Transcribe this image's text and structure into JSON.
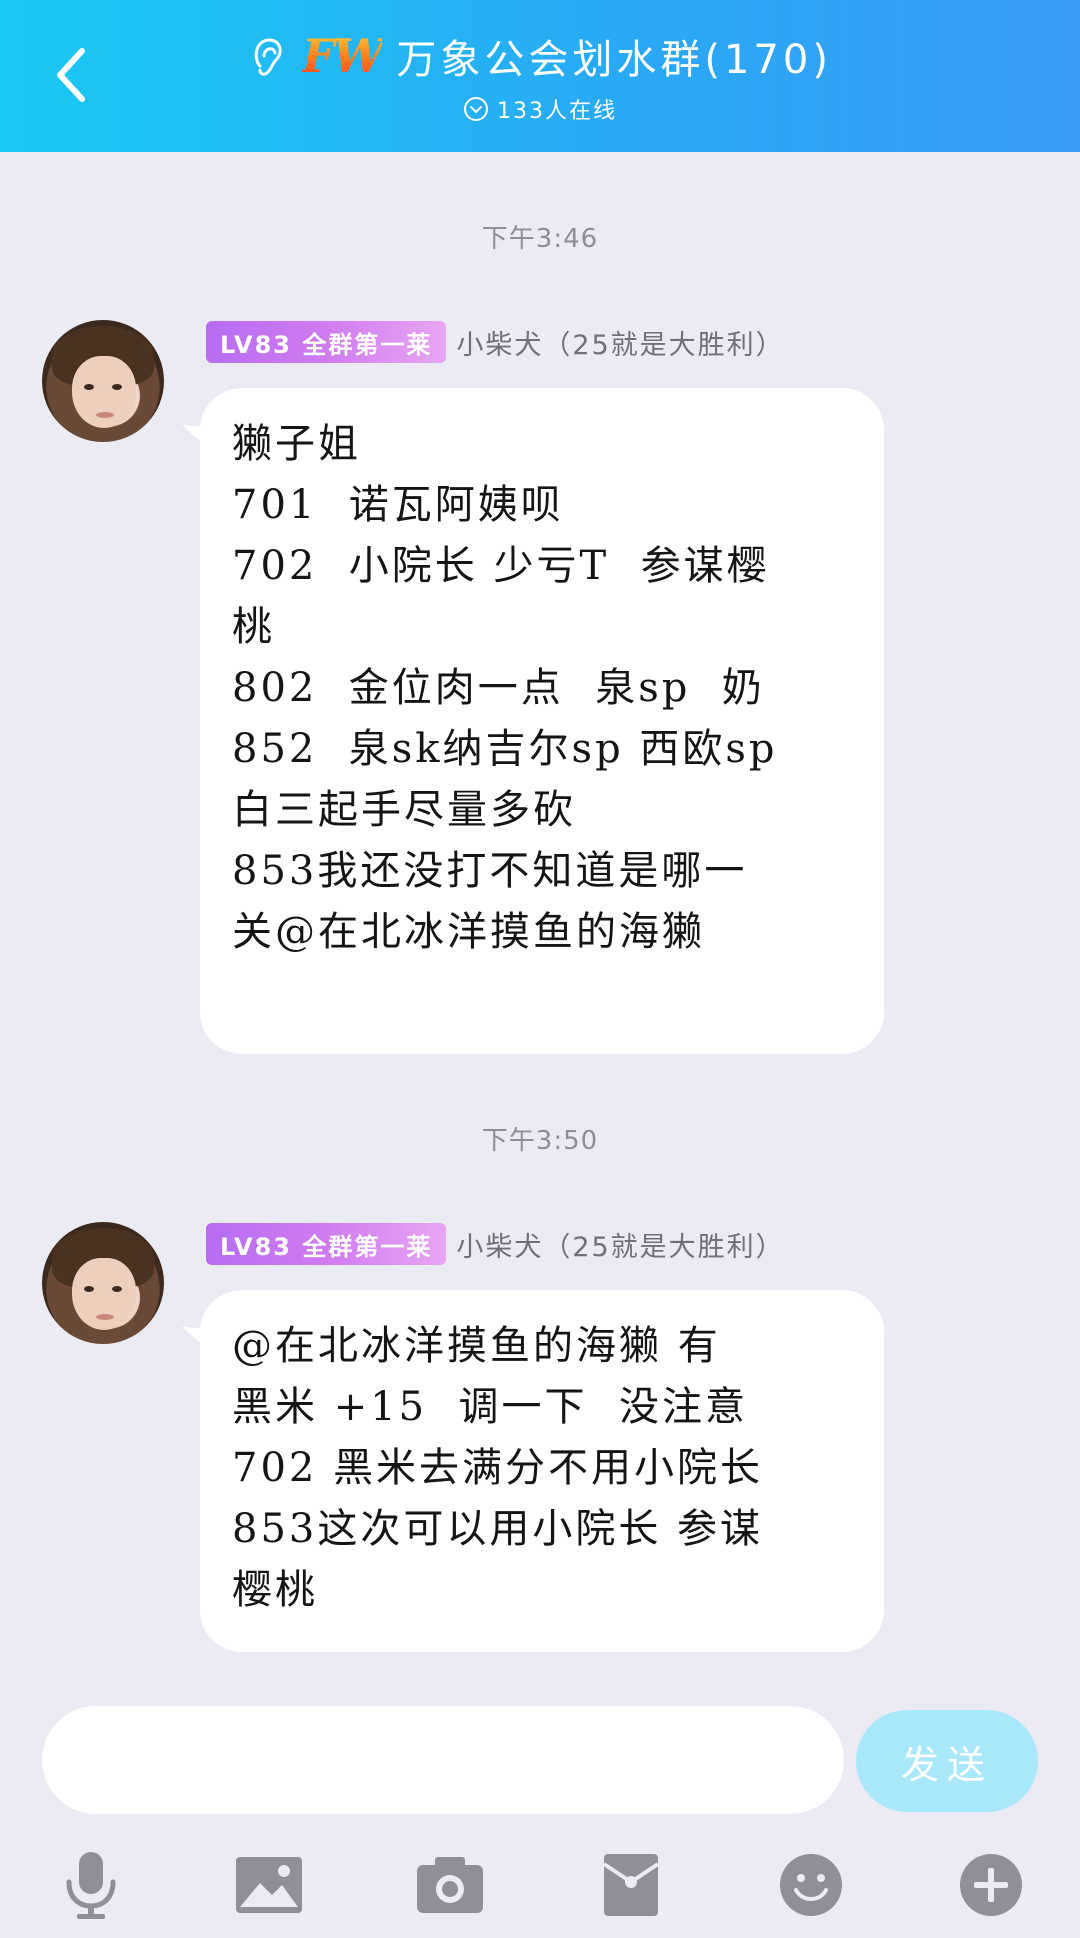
{
  "header": {
    "logo_text": "FW",
    "title": "万象公会划水群(170)",
    "online": "133人在线"
  },
  "messages": [
    {
      "time": "下午3:46",
      "badge": "LV83 全群第一莱",
      "sender": "小柴犬（25就是大胜利）",
      "lines": [
        "獭子姐",
        "701  诺瓦阿姨呗",
        "702  小院长 少亏T  参谋樱",
        "桃",
        "802  金位肉一点  泉sp  奶",
        "852  泉sk纳吉尔sp 西欧sp",
        "白三起手尽量多砍",
        "853我还没打不知道是哪一",
        "关@在北冰洋摸鱼的海獭"
      ]
    },
    {
      "time": "下午3:50",
      "badge": "LV83 全群第一莱",
      "sender": "小柴犬（25就是大胜利）",
      "lines": [
        "@在北冰洋摸鱼的海獭 有",
        "黑米 +15  调一下  没注意",
        "702 黑米去满分不用小院长",
        "853这次可以用小院长 参谋",
        "樱桃"
      ]
    }
  ],
  "composer": {
    "value": "",
    "send_label": "发送"
  },
  "toolbar": [
    "microphone-icon",
    "image-icon",
    "camera-icon",
    "red-packet-icon",
    "emoji-icon",
    "plus-icon"
  ],
  "colors": {
    "header_start": "#19c9f3",
    "header_end": "#3b9df7",
    "badge_start": "#b66cf2",
    "send_button": "#a9e8fa",
    "icon_gray": "#8f8f99",
    "background": "#ebebf3"
  }
}
